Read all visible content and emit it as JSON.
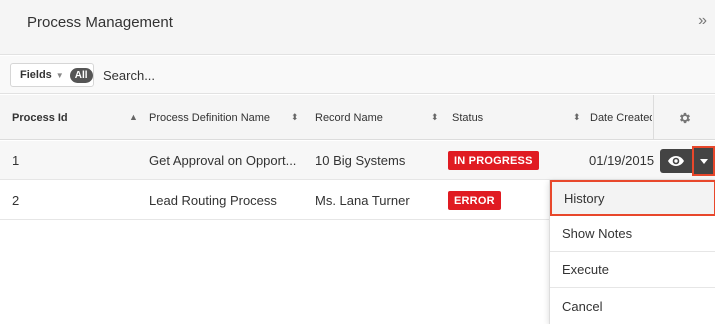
{
  "header": {
    "title": "Process Management",
    "collapse_glyph": "»"
  },
  "filter": {
    "fields_label": "Fields",
    "all_label": "All",
    "search_placeholder": "Search..."
  },
  "columns": [
    {
      "label": "Process Id",
      "sorted": "asc"
    },
    {
      "label": "Process Definition Name",
      "sorted": "none"
    },
    {
      "label": "Record Name",
      "sorted": "none"
    },
    {
      "label": "Status",
      "sorted": "none"
    },
    {
      "label": "Date Created",
      "sorted": "none"
    }
  ],
  "rows": [
    {
      "id": "1",
      "definition": "Get Approval on Opport...",
      "record": "10 Big Systems",
      "status": "IN PROGRESS",
      "date": "01/19/2015"
    },
    {
      "id": "2",
      "definition": "Lead Routing Process",
      "record": "Ms. Lana Turner",
      "status": "ERROR",
      "date": ""
    }
  ],
  "row_actions": {
    "view_icon": "eye-icon",
    "dropdown_icon": "caret-down-icon",
    "settings_icon": "gear-icon"
  },
  "menu": {
    "items": [
      "History",
      "Show Notes",
      "Execute",
      "Cancel"
    ],
    "highlighted": "History"
  },
  "colors": {
    "status_badge": "#e01b22",
    "highlight_border": "#e8472b",
    "action_button": "#444444"
  }
}
